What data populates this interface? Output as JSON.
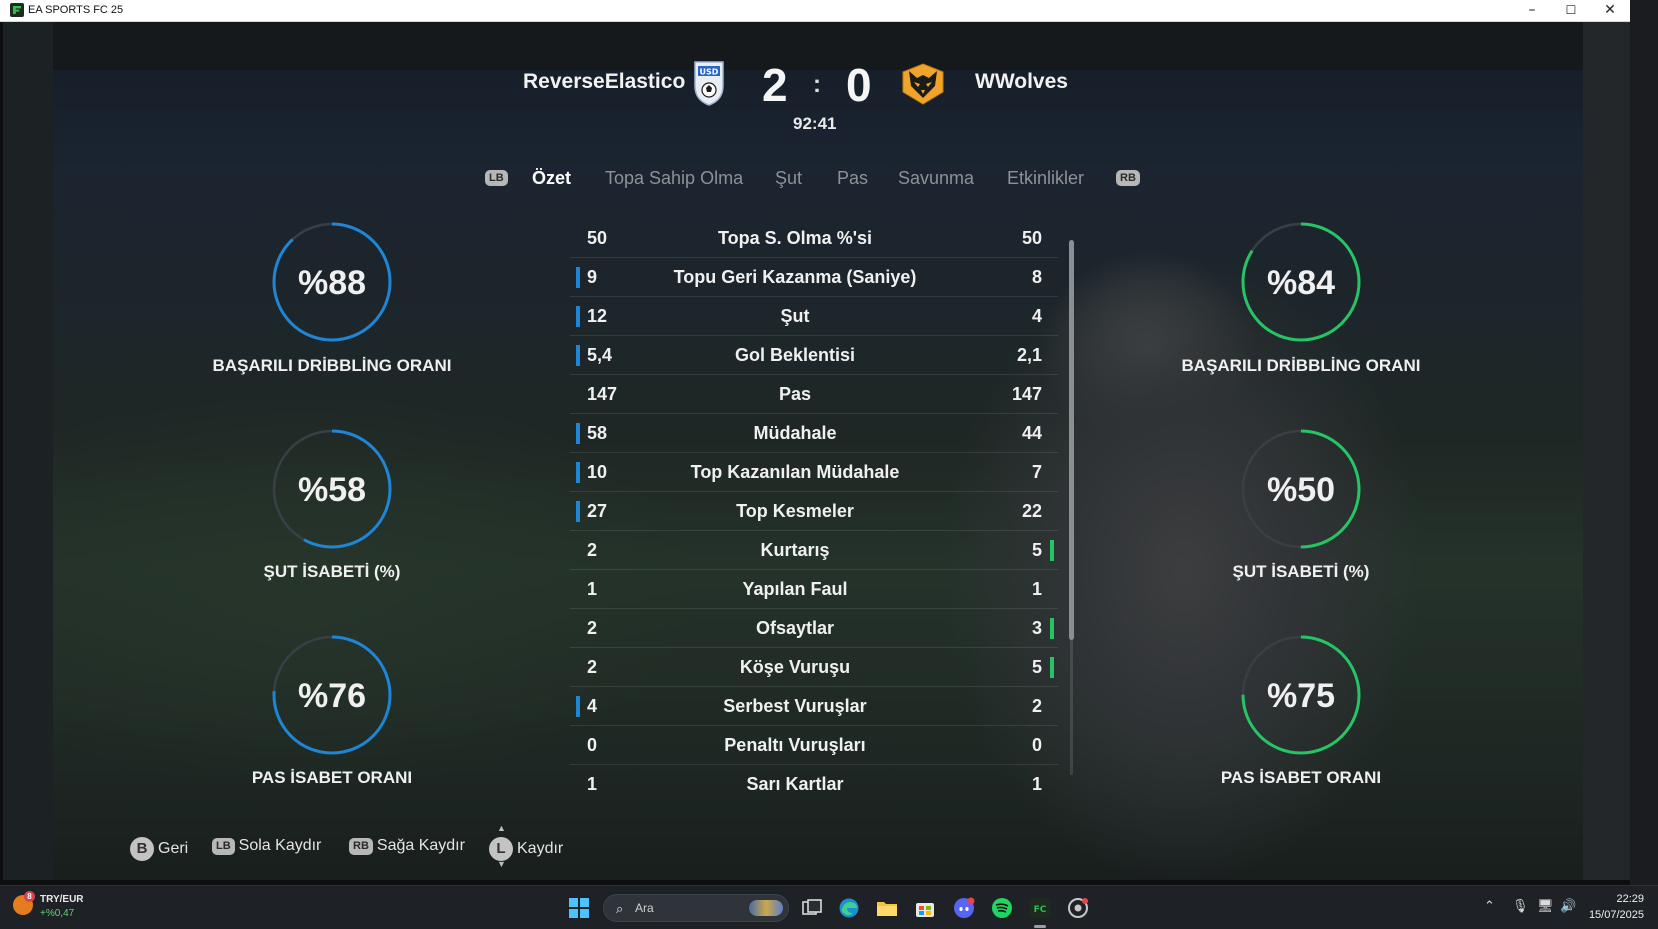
{
  "window": {
    "title": "EA SPORTS FC 25",
    "minimize": "–",
    "maximize": "☐",
    "close": "✕"
  },
  "match": {
    "home_team": "ReverseElastico",
    "away_team": "WWolves",
    "home_score": "2",
    "away_score": "0",
    "separator": ":",
    "clock": "92:41"
  },
  "tabs": {
    "lb": "LB",
    "rb": "RB",
    "items": [
      "Özet",
      "Topa Sahip Olma",
      "Şut",
      "Pas",
      "Savunma",
      "Etkinlikler"
    ],
    "active_index": 0
  },
  "home_rings": [
    {
      "value": "%88",
      "fraction": 0.88,
      "label": "BAŞARILI DRİBBLİNG ORANI"
    },
    {
      "value": "%58",
      "fraction": 0.58,
      "label": "ŞUT İSABETİ (%)"
    },
    {
      "value": "%76",
      "fraction": 0.76,
      "label": "PAS İSABET ORANI"
    }
  ],
  "away_rings": [
    {
      "value": "%84",
      "fraction": 0.84,
      "label": "BAŞARILI DRİBBLİNG ORANI"
    },
    {
      "value": "%50",
      "fraction": 0.5,
      "label": "ŞUT İSABETİ (%)"
    },
    {
      "value": "%75",
      "fraction": 0.75,
      "label": "PAS İSABET ORANI"
    }
  ],
  "colors": {
    "home_accent": "#1f86d6",
    "away_accent": "#26c465",
    "ring_track": "#3a3f45"
  },
  "stats": [
    {
      "home": "50",
      "label": "Topa S. Olma %'si",
      "away": "50",
      "leader": "none"
    },
    {
      "home": "9",
      "label": "Topu Geri Kazanma (Saniye)",
      "away": "8",
      "leader": "home"
    },
    {
      "home": "12",
      "label": "Şut",
      "away": "4",
      "leader": "home"
    },
    {
      "home": "5,4",
      "label": "Gol Beklentisi",
      "away": "2,1",
      "leader": "home"
    },
    {
      "home": "147",
      "label": "Pas",
      "away": "147",
      "leader": "none"
    },
    {
      "home": "58",
      "label": "Müdahale",
      "away": "44",
      "leader": "home"
    },
    {
      "home": "10",
      "label": "Top Kazanılan Müdahale",
      "away": "7",
      "leader": "home"
    },
    {
      "home": "27",
      "label": "Top Kesmeler",
      "away": "22",
      "leader": "home"
    },
    {
      "home": "2",
      "label": "Kurtarış",
      "away": "5",
      "leader": "away"
    },
    {
      "home": "1",
      "label": "Yapılan Faul",
      "away": "1",
      "leader": "none"
    },
    {
      "home": "2",
      "label": "Ofsaytlar",
      "away": "3",
      "leader": "away"
    },
    {
      "home": "2",
      "label": "Köşe Vuruşu",
      "away": "5",
      "leader": "away"
    },
    {
      "home": "4",
      "label": "Serbest Vuruşlar",
      "away": "2",
      "leader": "home"
    },
    {
      "home": "0",
      "label": "Penaltı Vuruşları",
      "away": "0",
      "leader": "none"
    },
    {
      "home": "1",
      "label": "Sarı Kartlar",
      "away": "1",
      "leader": "none"
    }
  ],
  "legend": {
    "back_key": "B",
    "back": "Geri",
    "left_key": "LB",
    "left": "Sola Kaydır",
    "right_key": "RB",
    "right": "Sağa Kaydır",
    "scroll_key": "L",
    "scroll": "Kaydır"
  },
  "taskbar": {
    "ticker_name": "TRY/EUR",
    "ticker_change": "+%0,47",
    "ticker_badge": "8",
    "search_placeholder": "Ara",
    "time": "22:29",
    "date": "15/07/2025"
  }
}
